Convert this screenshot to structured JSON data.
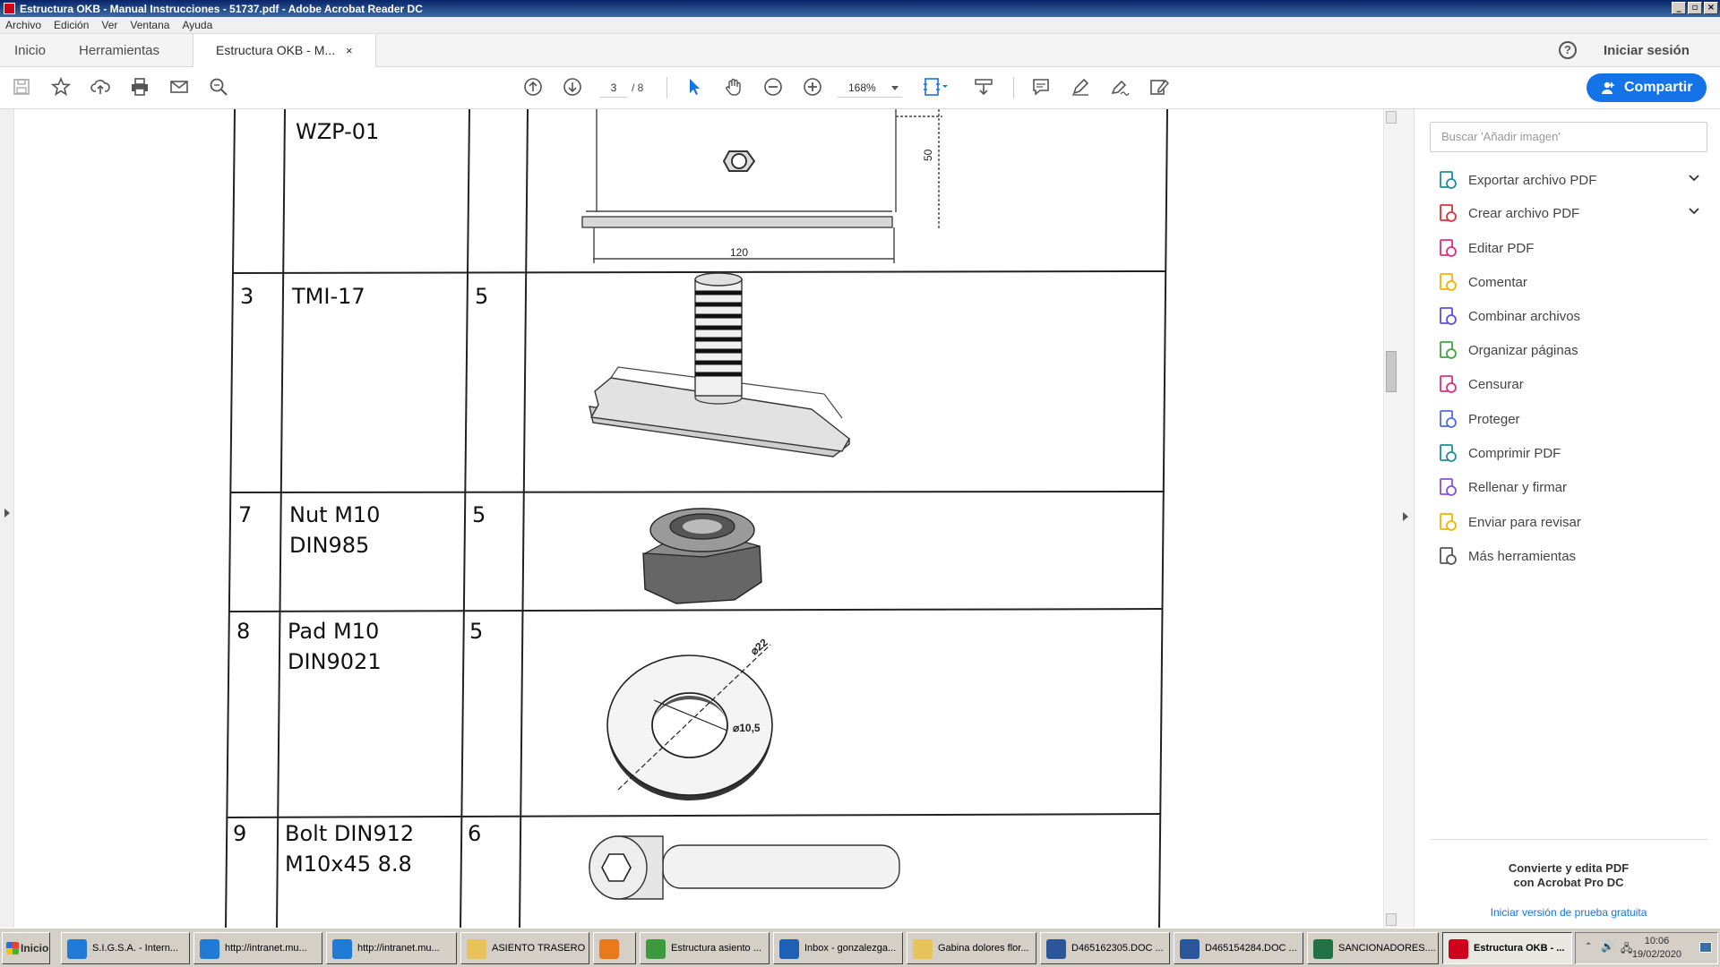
{
  "window": {
    "title": "Estructura OKB - Manual Instrucciones - 51737.pdf - Adobe Acrobat Reader DC",
    "controls": [
      "_",
      "▫",
      "×"
    ]
  },
  "menu": [
    "Archivo",
    "Edición",
    "Ver",
    "Ventana",
    "Ayuda"
  ],
  "tabs": {
    "home": "Inicio",
    "tools": "Herramientas",
    "document": "Estructura OKB - M...",
    "close": "×"
  },
  "header": {
    "help": "?",
    "signin": "Iniciar sesión"
  },
  "toolbar": {
    "current_page": "3",
    "total_pages": "/ 8",
    "zoom": "168%",
    "share_label": "Compartir"
  },
  "document": {
    "rows": [
      {
        "no": "",
        "name_lines": [
          "WZP-01"
        ],
        "qty": "",
        "dims": {
          "height": "50",
          "width": "120"
        }
      },
      {
        "no": "3",
        "name_lines": [
          "TMI-17"
        ],
        "qty": "5"
      },
      {
        "no": "7",
        "name_lines": [
          "Nut M10",
          "DIN985"
        ],
        "qty": "5"
      },
      {
        "no": "8",
        "name_lines": [
          "Pad M10",
          "DIN9021"
        ],
        "qty": "5",
        "dims": {
          "outer": "⌀22",
          "inner": "⌀10,5"
        }
      },
      {
        "no": "9",
        "name_lines": [
          "Bolt DIN912",
          "M10x45 8.8"
        ],
        "qty": "6"
      }
    ]
  },
  "right_panel": {
    "search_placeholder": "Buscar 'Añadir imagen'",
    "tools": [
      {
        "label": "Exportar archivo PDF",
        "icon": "export-pdf-icon",
        "color": "#1e8f9a",
        "expandable": true
      },
      {
        "label": "Crear archivo PDF",
        "icon": "create-pdf-icon",
        "color": "#e0303b",
        "expandable": true
      },
      {
        "label": "Editar PDF",
        "icon": "edit-pdf-icon",
        "color": "#e0307a"
      },
      {
        "label": "Comentar",
        "icon": "comment-icon",
        "color": "#f0b400"
      },
      {
        "label": "Combinar archivos",
        "icon": "combine-files-icon",
        "color": "#5a4fe0"
      },
      {
        "label": "Organizar páginas",
        "icon": "organize-pages-icon",
        "color": "#3fa83f"
      },
      {
        "label": "Censurar",
        "icon": "redact-icon",
        "color": "#e0307a"
      },
      {
        "label": "Proteger",
        "icon": "protect-icon",
        "color": "#4a6fe0"
      },
      {
        "label": "Comprimir PDF",
        "icon": "compress-pdf-icon",
        "color": "#1e8f9a"
      },
      {
        "label": "Rellenar y firmar",
        "icon": "fill-sign-icon",
        "color": "#8a4fe0"
      },
      {
        "label": "Enviar para revisar",
        "icon": "send-review-icon",
        "color": "#f0b400"
      },
      {
        "label": "Más herramientas",
        "icon": "more-tools-icon",
        "color": "#555555"
      }
    ],
    "promo_line1": "Convierte y edita PDF",
    "promo_line2": "con Acrobat Pro DC",
    "promo_link": "Iniciar versión de prueba gratuita"
  },
  "taskbar": {
    "start": "Inicio",
    "tasks": [
      {
        "label": "S.I.G.S.A. - Intern...",
        "icon": "ie-icon",
        "color": "#1f7bd6"
      },
      {
        "label": "http://intranet.mu...",
        "icon": "ie-icon",
        "color": "#1f7bd6"
      },
      {
        "label": "http://intranet.mu...",
        "icon": "ie-icon",
        "color": "#1f7bd6"
      },
      {
        "label": "ASIENTO TRASERO",
        "icon": "folder-icon",
        "color": "#e8c25a"
      },
      {
        "label": "",
        "icon": "media-player-icon",
        "color": "#e87a1a"
      },
      {
        "label": "Estructura asiento ...",
        "icon": "chrome-icon",
        "color": "#3c9a3c"
      },
      {
        "label": "Inbox - gonzalezga...",
        "icon": "outlook-icon",
        "color": "#1f5fb4"
      },
      {
        "label": "Gabina dolores flor...",
        "icon": "folder-icon",
        "color": "#e8c25a"
      },
      {
        "label": "D465162305.DOC ...",
        "icon": "word-icon",
        "color": "#2b579a"
      },
      {
        "label": "D465154284.DOC ...",
        "icon": "word-icon",
        "color": "#2b579a"
      },
      {
        "label": "SANCIONADORES....",
        "icon": "excel-icon",
        "color": "#217346"
      },
      {
        "label": "Estructura OKB - ...",
        "icon": "acrobat-icon",
        "color": "#d0021b",
        "active": true
      }
    ],
    "clock_time": "10:06",
    "clock_date": "19/02/2020"
  }
}
